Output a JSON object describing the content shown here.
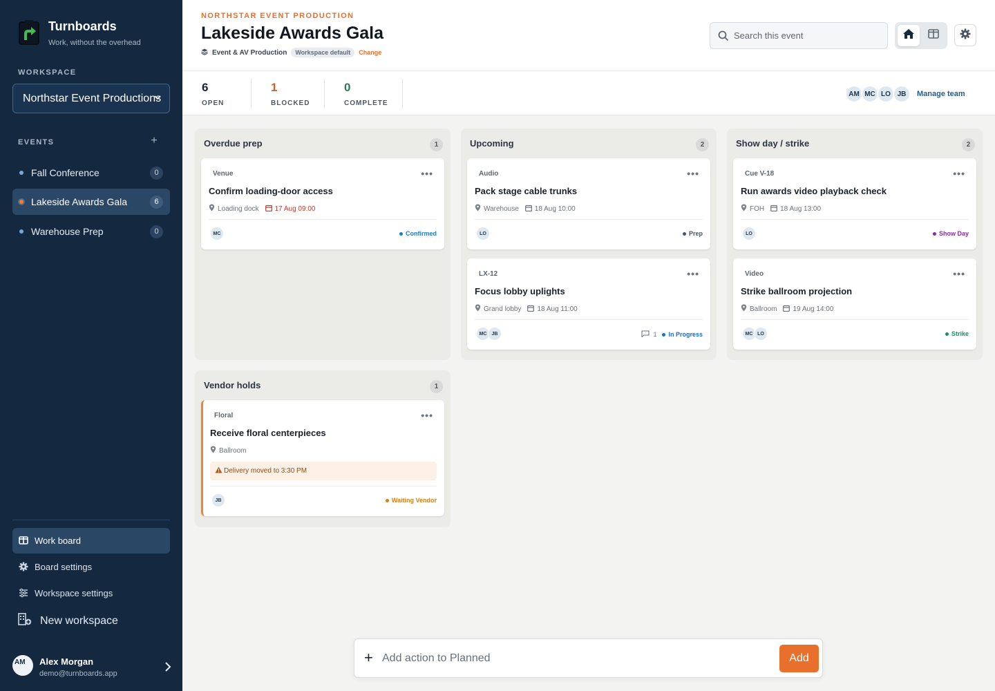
{
  "brand": {
    "title": "Turnboards",
    "subtitle": "Work, without the overhead"
  },
  "sidebar": {
    "workspace_label": "WORKSPACE",
    "workspace_value": "Northstar Event Productions",
    "events_label": "EVENTS",
    "events": [
      {
        "label": "Fall Conference",
        "count": "0"
      },
      {
        "label": "Lakeside Awards Gala",
        "count": "6",
        "active": true
      },
      {
        "label": "Warehouse Prep",
        "count": "0"
      }
    ],
    "nav": [
      {
        "label": "Work board",
        "icon": "board-icon",
        "active": true
      },
      {
        "label": "Board settings",
        "icon": "gear-icon"
      },
      {
        "label": "Workspace settings",
        "icon": "sliders-icon"
      }
    ],
    "new_workspace": "New workspace",
    "user": {
      "initials": "AM",
      "name": "Alex Morgan",
      "email": "demo@turnboards.app"
    }
  },
  "header": {
    "eyebrow": "NORTHSTAR EVENT PRODUCTION",
    "title": "Lakeside Awards Gala",
    "template": "Event & AV Production",
    "template_badge": "Workspace default",
    "change": "Change",
    "search_placeholder": "Search this event"
  },
  "stats": [
    {
      "value": "6",
      "label": "OPEN",
      "color": "#1b2430"
    },
    {
      "value": "1",
      "label": "BLOCKED",
      "color": "#c8622c"
    },
    {
      "value": "0",
      "label": "COMPLETE",
      "color": "#2f7a55"
    }
  ],
  "team": {
    "members": [
      "AM",
      "MC",
      "LO",
      "JB"
    ],
    "manage": "Manage team"
  },
  "columns": [
    {
      "title": "Overdue prep",
      "count": "1",
      "cards": [
        {
          "tag": "Venue",
          "title": "Confirm loading-door access",
          "location": "Loading dock",
          "date": "17 Aug 09:00",
          "overdue": true,
          "assignees": [
            "MC"
          ],
          "status": "Confirmed",
          "status_color": "#1a7fbd"
        }
      ]
    },
    {
      "title": "Upcoming",
      "count": "2",
      "cards": [
        {
          "tag": "Audio",
          "title": "Pack stage cable trunks",
          "location": "Warehouse",
          "date": "18 Aug 10:00",
          "assignees": [
            "LO"
          ],
          "status": "Prep",
          "status_color": "#4a5560"
        },
        {
          "tag": "LX-12",
          "title": "Focus lobby uplights",
          "location": "Grand lobby",
          "date": "18 Aug 11:00",
          "assignees": [
            "MC",
            "JB"
          ],
          "comments": "1",
          "status": "In Progress",
          "status_color": "#1a6fc9"
        }
      ]
    },
    {
      "title": "Show day / strike",
      "count": "2",
      "cards": [
        {
          "tag": "Cue V-18",
          "title": "Run awards video playback check",
          "location": "FOH",
          "date": "18 Aug 13:00",
          "assignees": [
            "LO"
          ],
          "status": "Show Day",
          "status_color": "#8a2aa8"
        },
        {
          "tag": "Video",
          "title": "Strike ballroom projection",
          "location": "Ballroom",
          "date": "19 Aug 14:00",
          "assignees": [
            "MC",
            "LO"
          ],
          "status": "Strike",
          "status_color": "#17906a"
        }
      ]
    },
    {
      "title": "Vendor holds",
      "count": "1",
      "cards": [
        {
          "tag": "Floral",
          "title": "Receive floral centerpieces",
          "location": "Ballroom",
          "alert": "Delivery moved to 3:30 PM",
          "assignees": [
            "JB"
          ],
          "status": "Waiting Vendor",
          "status_color": "#d97f0d"
        }
      ]
    }
  ],
  "add_bar": {
    "placeholder": "Add action to Planned",
    "button": "Add"
  }
}
